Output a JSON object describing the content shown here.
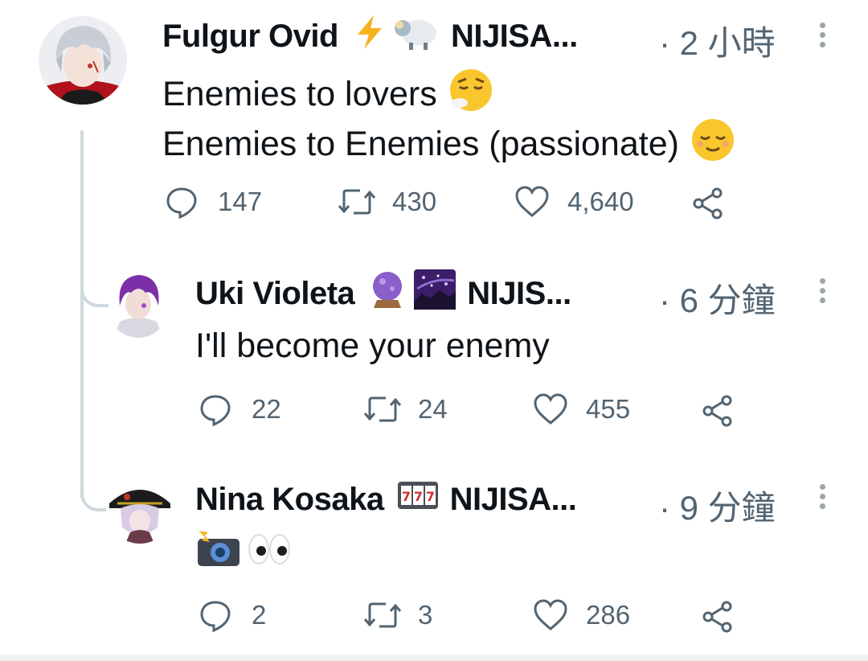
{
  "tweets": [
    {
      "name": "Fulgur Ovid",
      "badge_text": "NIJISA...",
      "time": "· 2 小時",
      "lines": [
        "Enemies to lovers",
        "Enemies to Enemies (passionate)"
      ],
      "reply_count": "147",
      "retweet_count": "430",
      "like_count": "4,640",
      "icons": [
        "lightning-emoji",
        "sheep-emoji",
        "exhaling-face-emoji",
        "relieved-face-emoji"
      ]
    },
    {
      "name": "Uki Violeta",
      "badge_text": "NIJIS...",
      "time": "· 6 分鐘",
      "lines": [
        "I'll become your enemy"
      ],
      "reply_count": "22",
      "retweet_count": "24",
      "like_count": "455",
      "icons": [
        "crystal-ball-emoji",
        "milky-way-emoji"
      ]
    },
    {
      "name": "Nina Kosaka",
      "badge_text": "NIJISA...",
      "time": "· 9 分鐘",
      "lines": [],
      "reply_count": "2",
      "retweet_count": "3",
      "like_count": "286",
      "icons": [
        "slot-machine-emoji",
        "camera-flash-emoji",
        "eyes-emoji"
      ]
    }
  ],
  "colors": {
    "text": "#0f1419",
    "secondary": "#536471",
    "thread_line": "#cfd9de"
  }
}
